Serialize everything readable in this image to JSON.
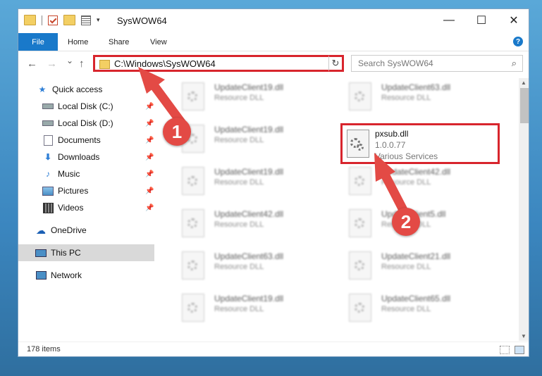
{
  "window": {
    "title": "SysWOW64",
    "controls": {
      "minimize": "—",
      "maximize": "☐",
      "close": "✕"
    }
  },
  "ribbon": {
    "tabs": [
      {
        "label": "File"
      },
      {
        "label": "Home"
      },
      {
        "label": "Share"
      },
      {
        "label": "View"
      }
    ],
    "help": "?"
  },
  "navigation": {
    "back": "←",
    "forward": "→",
    "recent": "⌄",
    "up": "↑",
    "address": "C:\\Windows\\SysWOW64",
    "refresh": "↻",
    "search_placeholder": "Search SysWOW64",
    "search_icon": "⌕"
  },
  "sidebar": {
    "items": [
      {
        "label": "Quick access",
        "icon": "star-icon"
      },
      {
        "label": "Local Disk (C:)",
        "icon": "drive-icon"
      },
      {
        "label": "Local Disk (D:)",
        "icon": "drive-icon"
      },
      {
        "label": "Documents",
        "icon": "documents-icon"
      },
      {
        "label": "Downloads",
        "icon": "download-icon"
      },
      {
        "label": "Music",
        "icon": "music-icon"
      },
      {
        "label": "Pictures",
        "icon": "pictures-icon"
      },
      {
        "label": "Videos",
        "icon": "videos-icon"
      },
      {
        "label": "OneDrive",
        "icon": "cloud-icon"
      },
      {
        "label": "This PC",
        "icon": "computer-icon"
      },
      {
        "label": "Network",
        "icon": "network-icon"
      }
    ]
  },
  "files": [
    {
      "name": "UpdateClient19.dll",
      "type": "Resource DLL"
    },
    {
      "name": "UpdateClient63.dll",
      "type": "Resource DLL"
    },
    {
      "name": "UpdateClient19.dll",
      "type": "Resource DLL"
    },
    {
      "name": "UpdateClient19.dll",
      "type": "Resource DLL"
    },
    {
      "name": "UpdateClient42.dll",
      "type": "Resource DLL"
    },
    {
      "name": "UpdateClient42.dll",
      "type": "Resource DLL"
    },
    {
      "name": "UpdateClient5.dll",
      "type": "Resource DLL"
    },
    {
      "name": "UpdateClient63.dll",
      "type": "Resource DLL"
    },
    {
      "name": "UpdateClient21.dll",
      "type": "Resource DLL"
    },
    {
      "name": "UpdateClient19.dll",
      "type": "Resource DLL"
    },
    {
      "name": "UpdateClient65.dll",
      "type": "Resource DLL"
    }
  ],
  "target_file": {
    "name": "pxsub.dll",
    "version": "1.0.0.77",
    "description": "Various Services"
  },
  "annotations": {
    "step1": "1",
    "step2": "2",
    "color": "#e34a45"
  },
  "status": {
    "item_count": "178 items"
  }
}
